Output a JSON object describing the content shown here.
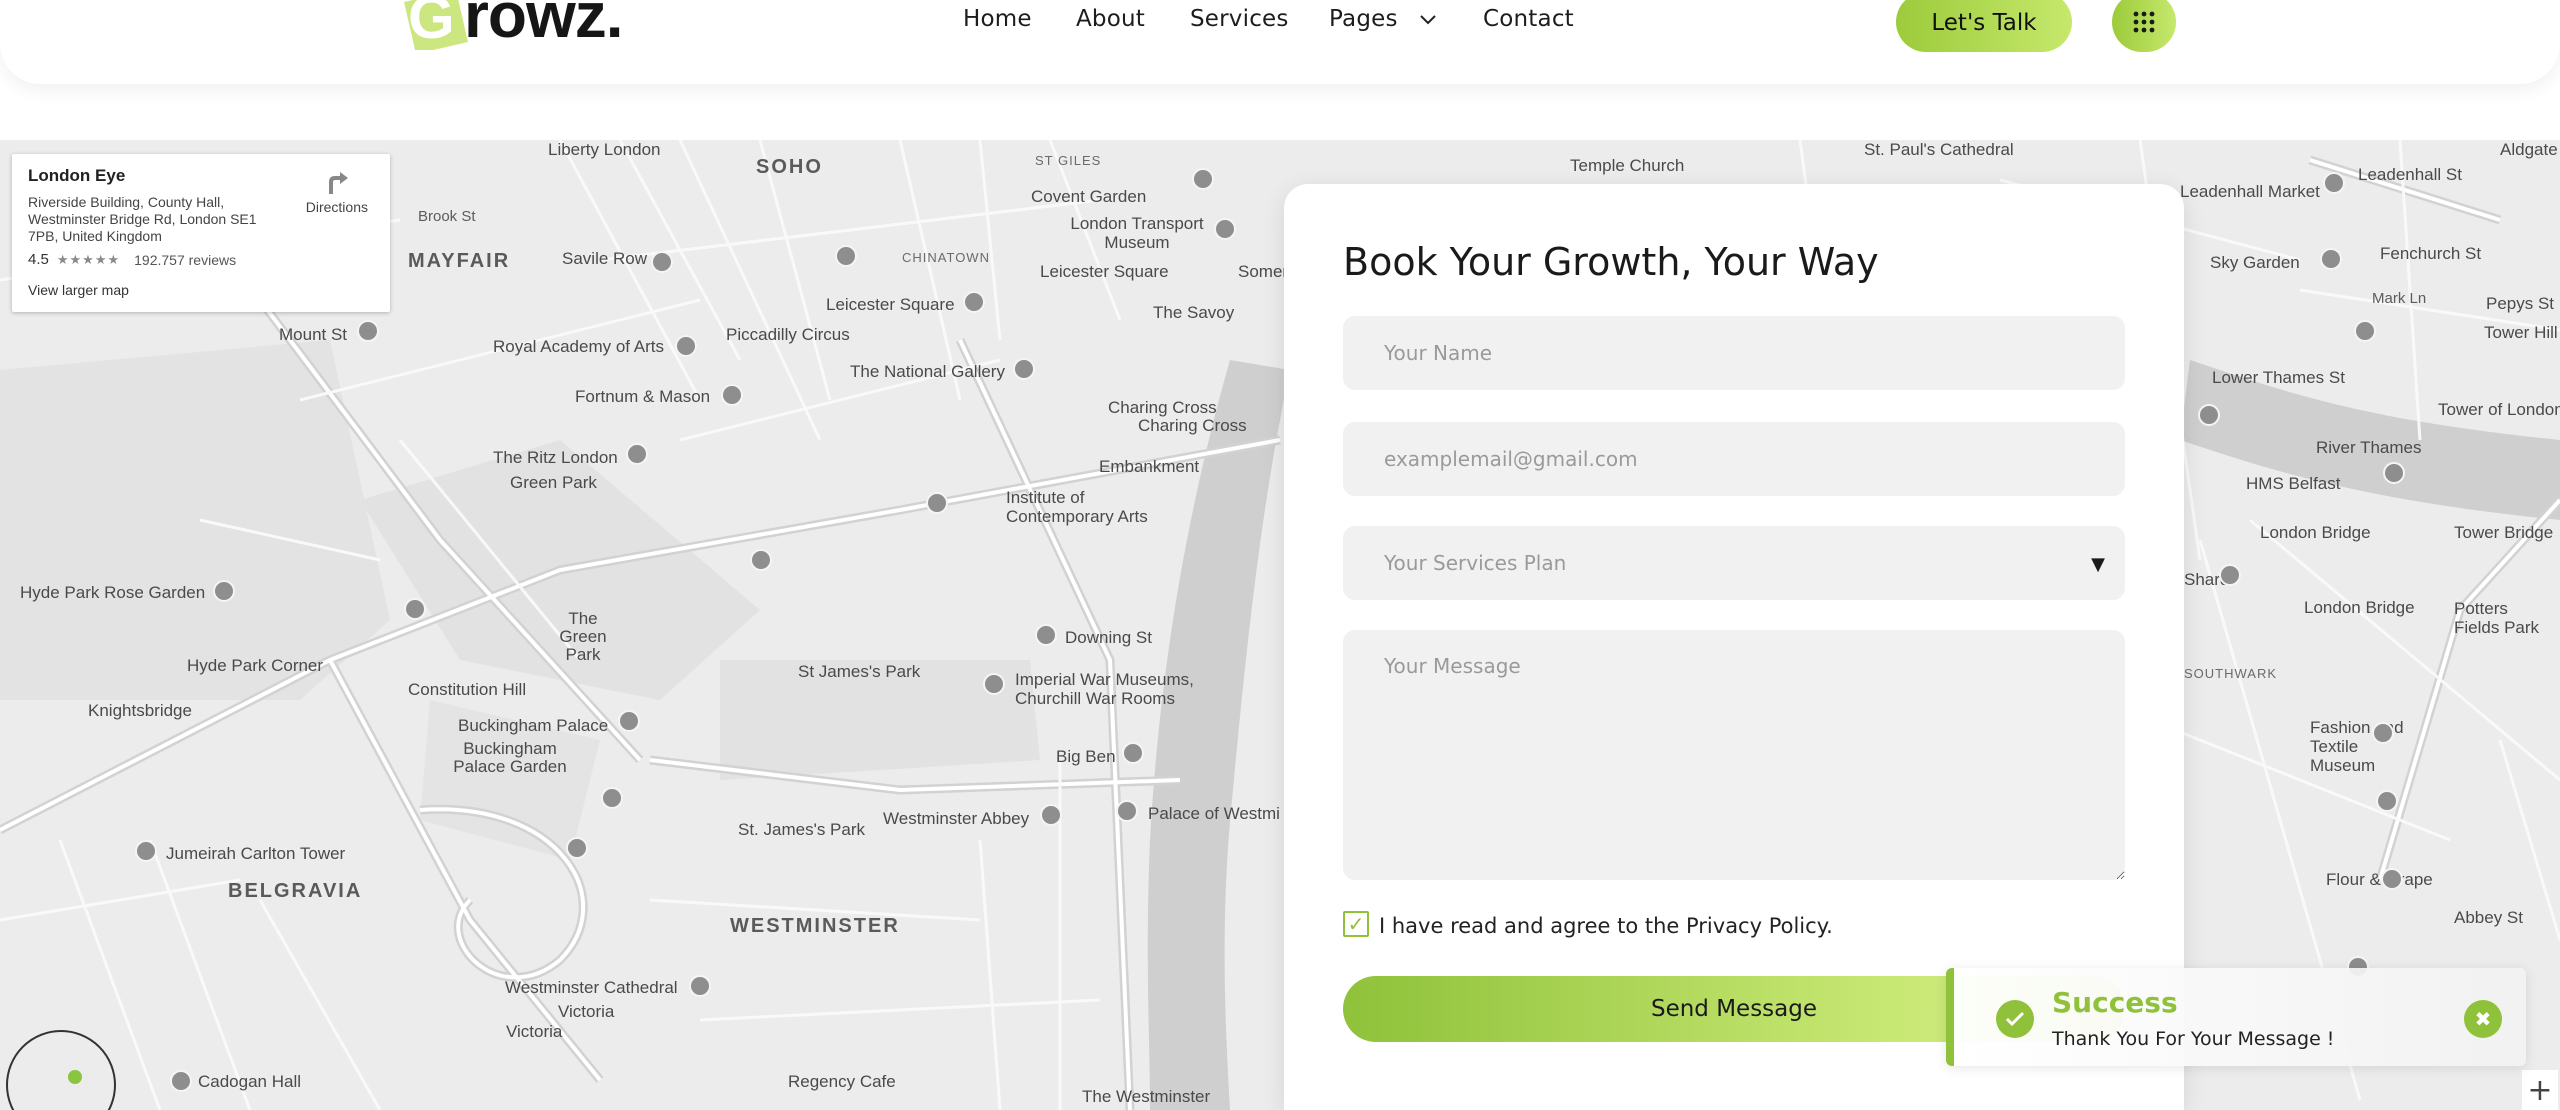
{
  "header": {
    "logo_text": "rowz.",
    "logo_letter": "G",
    "nav": [
      "Home",
      "About",
      "Services",
      "Pages",
      "Contact"
    ],
    "cta_label": "Let's Talk"
  },
  "map": {
    "info_card": {
      "title": "London Eye",
      "address": "Riverside Building, County Hall, Westminster Bridge Rd, London SE1 7PB, United Kingdom",
      "rating": "4.5",
      "stars": "★★★★★",
      "reviews": "192.757 reviews",
      "larger_map": "View larger map",
      "directions": "Directions"
    },
    "districts": [
      "SOHO",
      "MAYFAIR",
      "CHINATOWN",
      "BELGRAVIA",
      "WESTMINSTER",
      "ST GILES",
      "SOUTHWARK"
    ],
    "labels": [
      "Savile Row",
      "Piccadilly Circus",
      "Leicester Square",
      "Covent Garden",
      "Leicester Square",
      "London Transport Museum",
      "The National Gallery",
      "Charing Cross",
      "Charing Cross",
      "Royal Academy of Arts",
      "Fortnum & Mason",
      "The Ritz London",
      "Green Park",
      "Institute of Contemporary Arts",
      "Embankment",
      "Hyde Park Rose Garden",
      "Hyde Park Corner",
      "Constitution Hill",
      "The Green Park",
      "St James's Park",
      "Buckingham Palace",
      "Buckingham Palace Garden",
      "Imperial War Museums, Churchill War Rooms",
      "Downing St",
      "Big Ben",
      "Westminster Abbey",
      "Palace of Westmi",
      "St. James's Park",
      "Jumeirah Carlton Tower",
      "Westminster Cathedral",
      "Victoria",
      "Victoria",
      "Regency Cafe",
      "Cadogan Hall",
      "The Westminster",
      "Temple Church",
      "Somerset",
      "The Savoy",
      "Knightsbridge",
      "Mount St",
      "Brook St",
      "Leadenhall St",
      "Leadenhall Market",
      "Sky Garden",
      "Fenchurch St",
      "Tower Hill",
      "Tower of London",
      "HMS Belfast",
      "London Bridge",
      "London Bridge",
      "Tower Bridge",
      "Potters Fields Park",
      "Fashion and Textile Museum",
      "Flour & Grape",
      "Abbey St",
      "Lower Thames St",
      "River Thames",
      "Shard",
      "St. Paul's Cathedral",
      "Aldgate",
      "Pepys St",
      "Liberty London",
      "Mark Ln"
    ],
    "zoom_in": "+"
  },
  "form": {
    "title": "Book Your Growth, Your Way",
    "name_placeholder": "Your Name",
    "email_placeholder": "examplemail@gmail.com",
    "services_placeholder": "Your Services Plan",
    "message_placeholder": "Your Message",
    "privacy_label": "I have read and agree to the Privacy Policy.",
    "privacy_checked": true,
    "submit_label": "Send Message"
  },
  "toast": {
    "title": "Success",
    "message": "Thank You For Your Message !"
  },
  "colors": {
    "accent": "#8fc23a",
    "accent_light": "#c8e874",
    "map_bg": "#ececec"
  }
}
